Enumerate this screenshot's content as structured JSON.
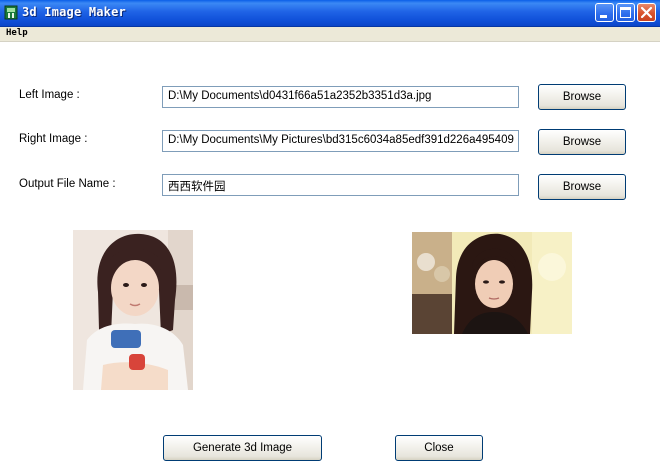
{
  "window": {
    "title": "3d Image Maker"
  },
  "menu": {
    "help": "Help"
  },
  "form": {
    "left_label": "Left Image :",
    "left_value": "D:\\My Documents\\d0431f66a51a2352b3351d3a.jpg",
    "right_label": "Right Image :",
    "right_value": "D:\\My Documents\\My Pictures\\bd315c6034a85edf391d226a495409",
    "output_label": "Output File Name :",
    "output_value": "西西软件园",
    "browse_label": "Browse"
  },
  "actions": {
    "generate_label": "Generate 3d Image",
    "close_label": "Close"
  },
  "colors": {
    "titlebar": "#1f63e6",
    "close_button": "#d9532c",
    "button_border": "#003c74",
    "field_border": "#7f9db9"
  }
}
